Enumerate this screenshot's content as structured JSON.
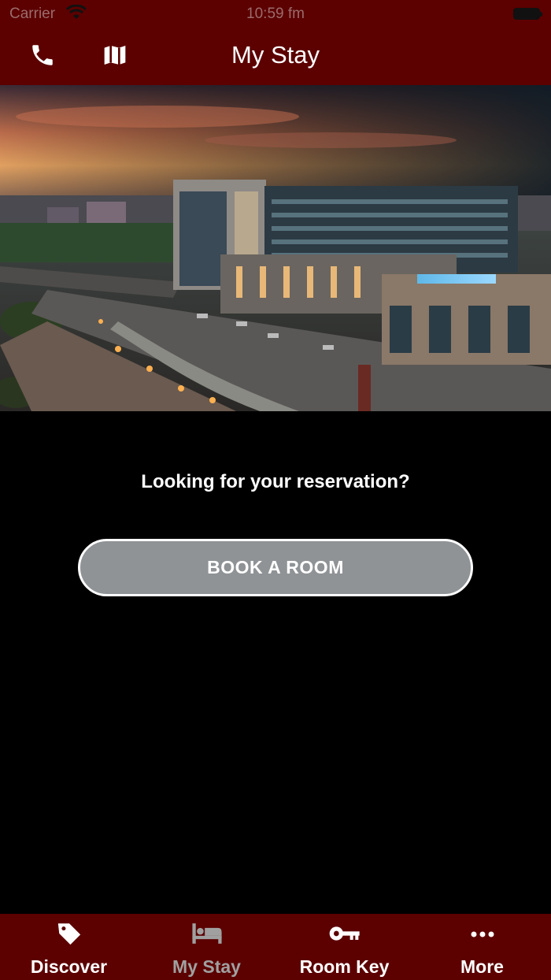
{
  "status_bar": {
    "carrier": "Carrier",
    "time": "10:59 fm"
  },
  "nav": {
    "title": "My Stay",
    "left_icons": [
      "phone-icon",
      "map-icon"
    ]
  },
  "hero": {
    "description_icon": "hotel-photo"
  },
  "content": {
    "prompt": "Looking for your reservation?",
    "book_button_label": "BOOK A ROOM"
  },
  "tabs": [
    {
      "label": "Discover",
      "icon": "tag-icon",
      "active": true
    },
    {
      "label": "My Stay",
      "icon": "bed-icon",
      "active": false
    },
    {
      "label": "Room Key",
      "icon": "key-icon",
      "active": true
    },
    {
      "label": "More",
      "icon": "more-icon",
      "active": true
    }
  ],
  "colors": {
    "brand_maroon": "#5c0000",
    "background": "#000000",
    "button_gray": "#8f9396",
    "inactive_tab": "#a0a0a0"
  }
}
